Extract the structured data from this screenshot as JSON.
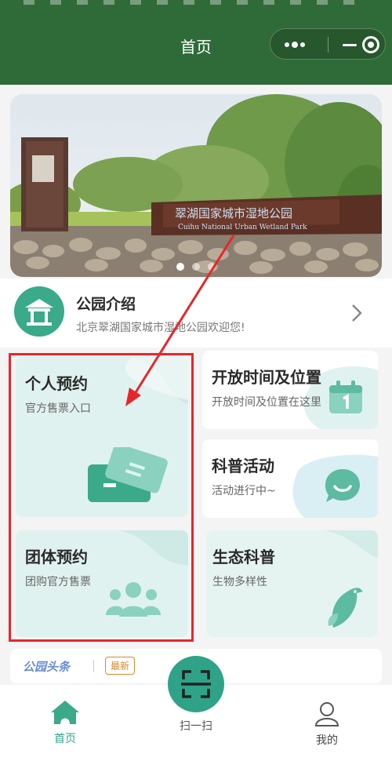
{
  "header": {
    "title": "首页"
  },
  "banner": {
    "sign_text": "翠湖国家城市湿地公园",
    "sign_text_en": "Cuihu National Urban Wetland Park",
    "slide_count": 3,
    "active_slide": 0
  },
  "intro": {
    "title": "公园介绍",
    "subtitle": "北京翠湖国家城市湿地公园欢迎您!"
  },
  "cards": {
    "personal": {
      "title": "个人预约",
      "subtitle": "官方售票入口"
    },
    "group": {
      "title": "团体预约",
      "subtitle": "团购官方售票"
    },
    "hours": {
      "title": "开放时间及位置",
      "subtitle": "开放时间及位置在这里"
    },
    "activity": {
      "title": "科普活动",
      "subtitle": "活动进行中~"
    },
    "ecology": {
      "title": "生态科普",
      "subtitle": "生物多样性"
    }
  },
  "headline": {
    "title": "公园头条",
    "badge": "最新"
  },
  "tabbar": {
    "home": "首页",
    "scan": "扫一扫",
    "mine": "我的"
  },
  "colors": {
    "header": "#2f6b38",
    "accent": "#2fa387",
    "highlight": "#e8262a"
  }
}
